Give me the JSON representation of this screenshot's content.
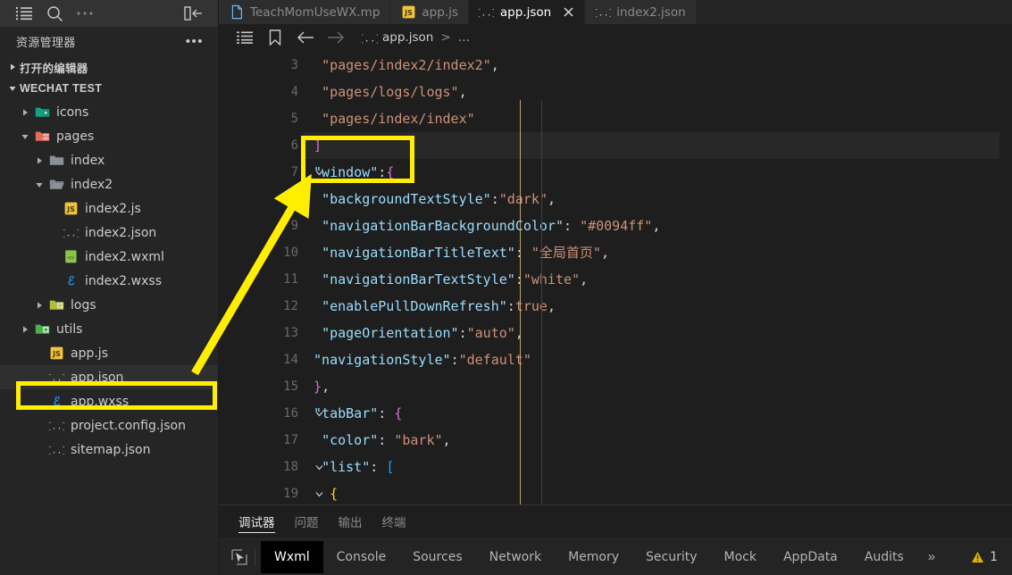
{
  "activitybar": {
    "icons": [
      "list-icon",
      "search-icon",
      "ellipsis-icon",
      "collapse-sidebar-icon"
    ]
  },
  "sidebar": {
    "title": "资源管理器",
    "more_label": "•••",
    "sections": [
      {
        "label": "打开的编辑器",
        "expanded": false
      },
      {
        "label": "WECHAT TEST",
        "expanded": true
      }
    ],
    "tree": [
      {
        "label": "icons",
        "kind": "folder-media",
        "indent": 1,
        "arrow": "collapsed",
        "selected": false
      },
      {
        "label": "pages",
        "kind": "folder-pages",
        "indent": 1,
        "arrow": "expanded",
        "selected": false
      },
      {
        "label": "index",
        "kind": "folder-plain",
        "indent": 2,
        "arrow": "collapsed",
        "selected": false
      },
      {
        "label": "index2",
        "kind": "folder-open",
        "indent": 2,
        "arrow": "expanded",
        "selected": false
      },
      {
        "label": "index2.js",
        "kind": "js",
        "indent": 3,
        "arrow": "none",
        "selected": false
      },
      {
        "label": "index2.json",
        "kind": "json",
        "indent": 3,
        "arrow": "none",
        "selected": false
      },
      {
        "label": "index2.wxml",
        "kind": "wxml",
        "indent": 3,
        "arrow": "none",
        "selected": false
      },
      {
        "label": "index2.wxss",
        "kind": "wxss",
        "indent": 3,
        "arrow": "none",
        "selected": false
      },
      {
        "label": "logs",
        "kind": "folder-logs",
        "indent": 2,
        "arrow": "collapsed",
        "selected": false
      },
      {
        "label": "utils",
        "kind": "folder-utils",
        "indent": 1,
        "arrow": "collapsed",
        "selected": false
      },
      {
        "label": "app.js",
        "kind": "js",
        "indent": 2,
        "arrow": "none",
        "selected": false
      },
      {
        "label": "app.json",
        "kind": "json",
        "indent": 2,
        "arrow": "none",
        "selected": true
      },
      {
        "label": "app.wxss",
        "kind": "wxss",
        "indent": 2,
        "arrow": "none",
        "selected": false
      },
      {
        "label": "project.config.json",
        "kind": "json",
        "indent": 2,
        "arrow": "none",
        "selected": false
      },
      {
        "label": "sitemap.json",
        "kind": "json",
        "indent": 2,
        "arrow": "none",
        "selected": false
      }
    ]
  },
  "tabs": [
    {
      "label": "TeachMomUseWX.mp",
      "kind": "file",
      "active": false,
      "closable": false
    },
    {
      "label": "app.js",
      "kind": "js",
      "active": false,
      "closable": false
    },
    {
      "label": "app.json",
      "kind": "json",
      "active": true,
      "closable": true
    },
    {
      "label": "index2.json",
      "kind": "json",
      "active": false,
      "closable": false
    }
  ],
  "breadcrumb": {
    "icons": [
      "outline-icon",
      "bookmark-icon",
      "back-arrow-icon",
      "forward-arrow-icon"
    ],
    "file": "app.json",
    "separator": ">",
    "tail": "…"
  },
  "editor": {
    "lines": [
      {
        "n": "3",
        "fold": "none",
        "current": false,
        "tokens": [
          {
            "t": "  ",
            "c": "p"
          },
          {
            "t": "\"pages/index2/index2\"",
            "c": "s"
          },
          {
            "t": ",",
            "c": "p"
          }
        ]
      },
      {
        "n": "4",
        "fold": "none",
        "current": false,
        "tokens": [
          {
            "t": "  ",
            "c": "p"
          },
          {
            "t": "\"pages/logs/logs\"",
            "c": "s"
          },
          {
            "t": ",",
            "c": "p"
          }
        ]
      },
      {
        "n": "5",
        "fold": "none",
        "current": false,
        "tokens": [
          {
            "t": "  ",
            "c": "p"
          },
          {
            "t": "\"pages/index/index\"",
            "c": "s"
          }
        ]
      },
      {
        "n": "6",
        "fold": "none",
        "current": true,
        "tokens": [
          {
            "t": " ",
            "c": "p"
          },
          {
            "t": "]",
            "c": "br"
          }
        ]
      },
      {
        "n": "7",
        "fold": "expanded",
        "current": false,
        "tokens": [
          {
            "t": " ",
            "c": "p"
          },
          {
            "t": "\"window\"",
            "c": "k"
          },
          {
            "t": ":",
            "c": "p"
          },
          {
            "t": "{",
            "c": "br"
          }
        ]
      },
      {
        "n": "8",
        "fold": "none",
        "current": false,
        "tokens": [
          {
            "t": "  ",
            "c": "p"
          },
          {
            "t": "\"backgroundTextStyle\"",
            "c": "k"
          },
          {
            "t": ":",
            "c": "p"
          },
          {
            "t": "\"dark\"",
            "c": "s"
          },
          {
            "t": ",",
            "c": "p"
          }
        ]
      },
      {
        "n": "9",
        "fold": "none",
        "current": false,
        "tokens": [
          {
            "t": "  ",
            "c": "p"
          },
          {
            "t": "\"navigationBarBackgroundColor\"",
            "c": "k"
          },
          {
            "t": ": ",
            "c": "p"
          },
          {
            "t": "\"#0094ff\"",
            "c": "s"
          },
          {
            "t": ",",
            "c": "p"
          }
        ]
      },
      {
        "n": "10",
        "fold": "none",
        "current": false,
        "tokens": [
          {
            "t": "  ",
            "c": "p"
          },
          {
            "t": "\"navigationBarTitleText\"",
            "c": "k"
          },
          {
            "t": ": ",
            "c": "p"
          },
          {
            "t": "\"全局首页\"",
            "c": "s"
          },
          {
            "t": ",",
            "c": "p"
          }
        ]
      },
      {
        "n": "11",
        "fold": "none",
        "current": false,
        "tokens": [
          {
            "t": "  ",
            "c": "p"
          },
          {
            "t": "\"navigationBarTextStyle\"",
            "c": "k"
          },
          {
            "t": ":",
            "c": "p"
          },
          {
            "t": "\"white\"",
            "c": "s"
          },
          {
            "t": ",",
            "c": "p"
          }
        ]
      },
      {
        "n": "12",
        "fold": "none",
        "current": false,
        "tokens": [
          {
            "t": "  ",
            "c": "p"
          },
          {
            "t": "\"enablePullDownRefresh\"",
            "c": "k"
          },
          {
            "t": ":",
            "c": "p"
          },
          {
            "t": "true",
            "c": "s"
          },
          {
            "t": ",",
            "c": "p"
          }
        ]
      },
      {
        "n": "13",
        "fold": "none",
        "current": false,
        "tokens": [
          {
            "t": "  ",
            "c": "p"
          },
          {
            "t": "\"pageOrientation\"",
            "c": "k"
          },
          {
            "t": ":",
            "c": "p"
          },
          {
            "t": "\"auto\"",
            "c": "s"
          },
          {
            "t": ",",
            "c": "p"
          }
        ]
      },
      {
        "n": "14",
        "fold": "none",
        "current": false,
        "tokens": [
          {
            "t": " ",
            "c": "p"
          },
          {
            "t": "\"navigationStyle\"",
            "c": "k"
          },
          {
            "t": ":",
            "c": "p"
          },
          {
            "t": "\"default\"",
            "c": "s"
          }
        ]
      },
      {
        "n": "15",
        "fold": "none",
        "current": false,
        "tokens": [
          {
            "t": " ",
            "c": "p"
          },
          {
            "t": "}",
            "c": "br"
          },
          {
            "t": ",",
            "c": "p"
          }
        ]
      },
      {
        "n": "16",
        "fold": "expanded",
        "current": false,
        "tokens": [
          {
            "t": " ",
            "c": "p"
          },
          {
            "t": "\"tabBar\"",
            "c": "k"
          },
          {
            "t": ": ",
            "c": "p"
          },
          {
            "t": "{",
            "c": "br"
          }
        ]
      },
      {
        "n": "17",
        "fold": "none",
        "current": false,
        "tokens": [
          {
            "t": "  ",
            "c": "p"
          },
          {
            "t": "\"color\"",
            "c": "k"
          },
          {
            "t": ": ",
            "c": "p"
          },
          {
            "t": "\"bark\"",
            "c": "s"
          },
          {
            "t": ",",
            "c": "p"
          }
        ]
      },
      {
        "n": "18",
        "fold": "expanded",
        "current": false,
        "tokens": [
          {
            "t": "  ",
            "c": "p"
          },
          {
            "t": "\"list\"",
            "c": "k"
          },
          {
            "t": ": ",
            "c": "p"
          },
          {
            "t": "[",
            "c": "br3"
          }
        ]
      },
      {
        "n": "19",
        "fold": "expanded",
        "current": false,
        "tokens": [
          {
            "t": "   ",
            "c": "p"
          },
          {
            "t": "{",
            "c": "br2"
          }
        ]
      }
    ]
  },
  "panel": {
    "tabs": [
      {
        "label": "调试器",
        "active": true
      },
      {
        "label": "问题",
        "active": false
      },
      {
        "label": "输出",
        "active": false
      },
      {
        "label": "终端",
        "active": false
      }
    ],
    "devtools": {
      "picker_icon": "element-picker-icon",
      "tabs": [
        {
          "label": "Wxml",
          "active": true
        },
        {
          "label": "Console",
          "active": false
        },
        {
          "label": "Sources",
          "active": false
        },
        {
          "label": "Network",
          "active": false
        },
        {
          "label": "Memory",
          "active": false
        },
        {
          "label": "Security",
          "active": false
        },
        {
          "label": "Mock",
          "active": false
        },
        {
          "label": "AppData",
          "active": false
        },
        {
          "label": "Audits",
          "active": false
        }
      ],
      "more": "»",
      "warning_icon": "warning-triangle-icon",
      "warning_count": "1"
    }
  },
  "annotations": {
    "highlight_color": "#ffee00",
    "boxes": [
      "app-json-file-row",
      "window-key-line"
    ],
    "arrow": "arrow-from-app-json-to-window-key"
  }
}
